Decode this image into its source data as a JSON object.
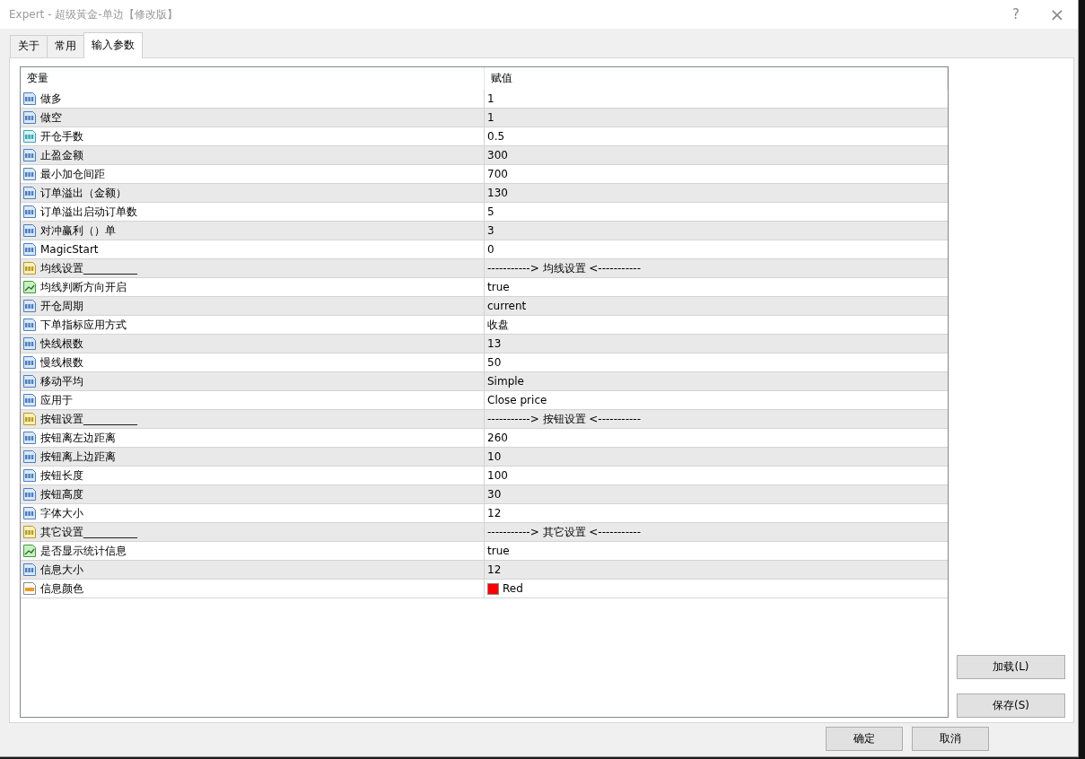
{
  "window": {
    "title": "Expert - 超级黃金-单边【修改版】",
    "help": "?",
    "close": "×"
  },
  "tabs": [
    {
      "label": "关于",
      "selected": false
    },
    {
      "label": "常用",
      "selected": false
    },
    {
      "label": "输入参数",
      "selected": true
    }
  ],
  "table": {
    "columns": [
      "变量",
      "赋值"
    ],
    "rows": [
      {
        "kind": "int",
        "name": "做多",
        "value": "1"
      },
      {
        "kind": "int",
        "name": "做空",
        "value": "1"
      },
      {
        "kind": "double",
        "name": "开仓手数",
        "value": "0.5"
      },
      {
        "kind": "int",
        "name": "止盈金额",
        "value": "300"
      },
      {
        "kind": "int",
        "name": "最小加仓间距",
        "value": "700"
      },
      {
        "kind": "int",
        "name": "订单溢出（金额）",
        "value": "130"
      },
      {
        "kind": "int",
        "name": "订单溢出启动订单数",
        "value": "5"
      },
      {
        "kind": "int",
        "name": "对冲赢利（）单",
        "value": "3"
      },
      {
        "kind": "int",
        "name": "MagicStart",
        "value": "0"
      },
      {
        "kind": "string",
        "name": "均线设置__________",
        "value": "-----------> 均线设置 <-----------"
      },
      {
        "kind": "bool",
        "name": "均线判断方向开启",
        "value": "true"
      },
      {
        "kind": "int",
        "name": "开仓周期",
        "value": "current"
      },
      {
        "kind": "int",
        "name": "下单指标应用方式",
        "value": "收盘"
      },
      {
        "kind": "int",
        "name": "快线根数",
        "value": "13"
      },
      {
        "kind": "int",
        "name": "慢线根数",
        "value": "50"
      },
      {
        "kind": "int",
        "name": "移动平均",
        "value": "Simple"
      },
      {
        "kind": "int",
        "name": "应用于",
        "value": "Close price"
      },
      {
        "kind": "string",
        "name": "按钮设置__________",
        "value": "-----------> 按钮设置 <-----------"
      },
      {
        "kind": "int",
        "name": "按钮离左边距离",
        "value": "260"
      },
      {
        "kind": "int",
        "name": "按钮离上边距离",
        "value": "10"
      },
      {
        "kind": "int",
        "name": "按钮长度",
        "value": "100"
      },
      {
        "kind": "int",
        "name": "按钮高度",
        "value": "30"
      },
      {
        "kind": "int",
        "name": "字体大小",
        "value": "12"
      },
      {
        "kind": "string",
        "name": "其它设置__________",
        "value": "-----------> 其它设置 <-----------"
      },
      {
        "kind": "bool",
        "name": "是否显示统计信息",
        "value": "true"
      },
      {
        "kind": "int",
        "name": "信息大小",
        "value": "12"
      },
      {
        "kind": "color",
        "name": "信息颜色",
        "value": "Red",
        "color": "#ff0000"
      }
    ]
  },
  "side_buttons": [
    "加载(L)",
    "保存(S)"
  ],
  "bottom_buttons": [
    "确定",
    "取消"
  ]
}
